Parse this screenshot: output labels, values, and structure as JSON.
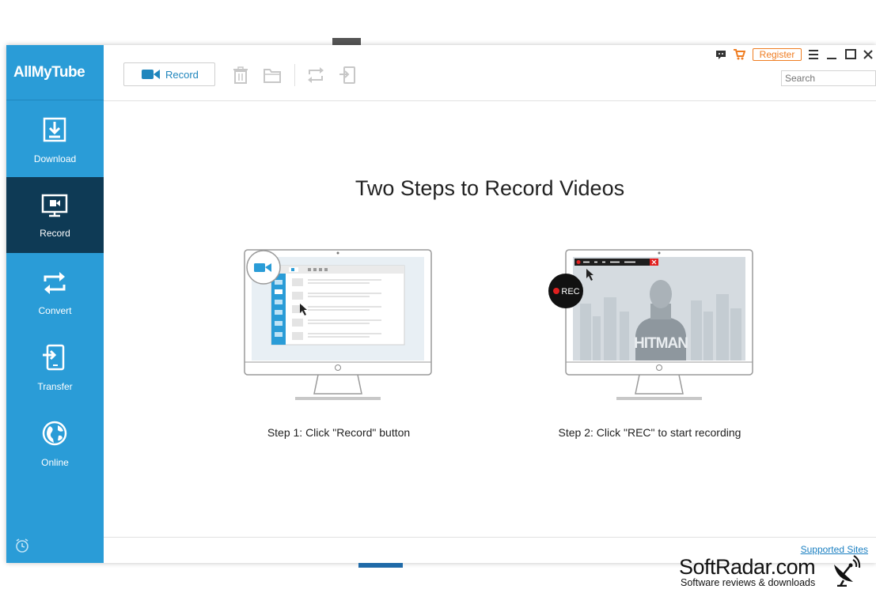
{
  "app": {
    "brand": "AllMyTube",
    "accent_color": "#2a9cd7",
    "active_color": "#0e3a55"
  },
  "sidebar": {
    "items": [
      {
        "label": "Download",
        "icon": "download-icon"
      },
      {
        "label": "Record",
        "icon": "monitor-record-icon",
        "active": true
      },
      {
        "label": "Convert",
        "icon": "convert-icon"
      },
      {
        "label": "Transfer",
        "icon": "transfer-icon"
      },
      {
        "label": "Online",
        "icon": "globe-icon"
      }
    ],
    "bottom_icon": "alarm-clock-icon"
  },
  "toolbar": {
    "record_label": "Record",
    "icons": [
      "trash-icon",
      "folder-icon",
      "convert-icon",
      "import-icon"
    ]
  },
  "titlebar": {
    "register_label": "Register",
    "icons": [
      "chat-icon",
      "cart-icon",
      "menu-icon",
      "minimize-icon",
      "maximize-icon",
      "close-icon"
    ]
  },
  "search": {
    "placeholder": "Search"
  },
  "main": {
    "headline": "Two Steps to Record Videos",
    "step1": "Step 1: Click \"Record\" button",
    "step2": "Step 2: Click \"REC\" to start recording",
    "rec_badge": "REC",
    "hitman_label": "HITMAN"
  },
  "footer": {
    "supported_sites": "Supported Sites"
  },
  "watermark": {
    "title": "SoftRadar.com",
    "subtitle": "Software reviews & downloads"
  }
}
